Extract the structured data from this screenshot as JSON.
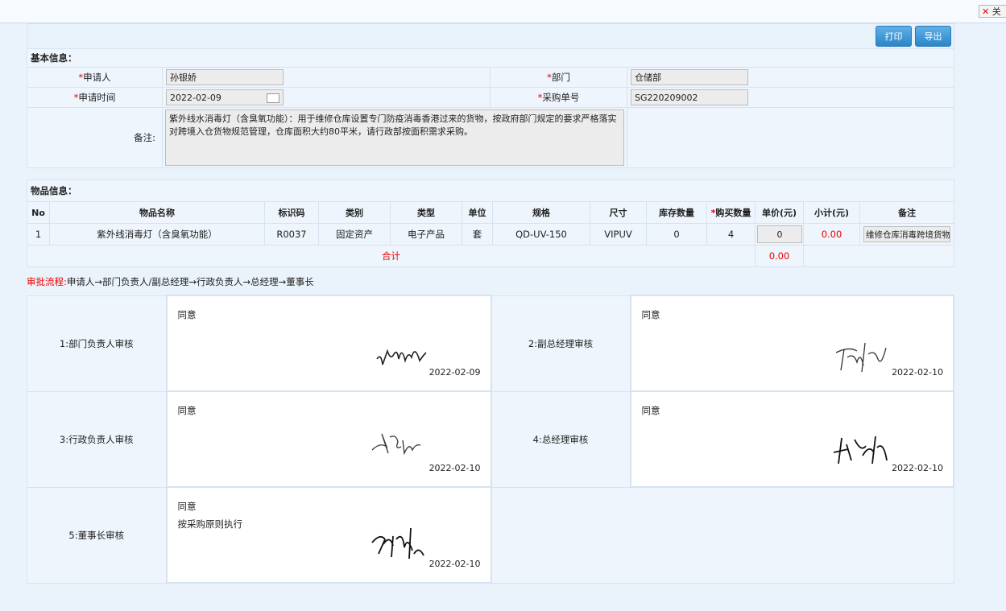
{
  "window": {
    "close_label": "关"
  },
  "toolbar": {
    "print_label": "打印",
    "export_label": "导出"
  },
  "basic": {
    "section_title": "基本信息：",
    "applicant_label": "申请人",
    "applicant_value": "孙银娇",
    "dept_label": "部门",
    "dept_value": "仓储部",
    "time_label": "申请时间",
    "time_value": "2022-02-09",
    "order_label": "采购单号",
    "order_value": "SG220209002",
    "memo_label": "备注:",
    "memo_value": "紫外线水消毒灯（含臭氧功能）：用于维修仓库设置专门防疫消毒香港过来的货物，按政府部门规定的要求严格落实对跨境入仓货物规范管理，仓库面积大约80平米，请行政部按面积需求采购。"
  },
  "items": {
    "section_title": "物品信息：",
    "headers": [
      "No",
      "物品名称",
      "标识码",
      "类别",
      "类型",
      "单位",
      "规格",
      "尺寸",
      "库存数量",
      "购买数量",
      "单价(元)",
      "小计(元)",
      "备注"
    ],
    "rows": [
      {
        "no": "1",
        "name": "紫外线消毒灯（含臭氧功能）",
        "code": "R0037",
        "category": "固定资产",
        "type": "电子产品",
        "unit": "套",
        "spec": "QD-UV-150",
        "size": "VIPUV",
        "stock": "0",
        "qty": "4",
        "price": "0",
        "subtotal": "0.00",
        "remark": "维修仓库消毒跨境货物"
      }
    ],
    "total_label": "合计",
    "total_value": "0.00"
  },
  "flow": {
    "label": "审批流程:",
    "steps": "申请人→部门负责人/副总经理→行政负责人→总经理→董事长"
  },
  "approvals": [
    {
      "label": "1:部门负责人审核",
      "opinion": "同意",
      "note": "",
      "date": "2022-02-09"
    },
    {
      "label": "2:副总经理审核",
      "opinion": "同意",
      "note": "",
      "date": "2022-02-10"
    },
    {
      "label": "3:行政负责人审核",
      "opinion": "同意",
      "note": "",
      "date": "2022-02-10"
    },
    {
      "label": "4:总经理审核",
      "opinion": "同意",
      "note": "",
      "date": "2022-02-10"
    },
    {
      "label": "5:董事长审核",
      "opinion": "同意",
      "note": "按采购原则执行",
      "date": "2022-02-10"
    }
  ]
}
